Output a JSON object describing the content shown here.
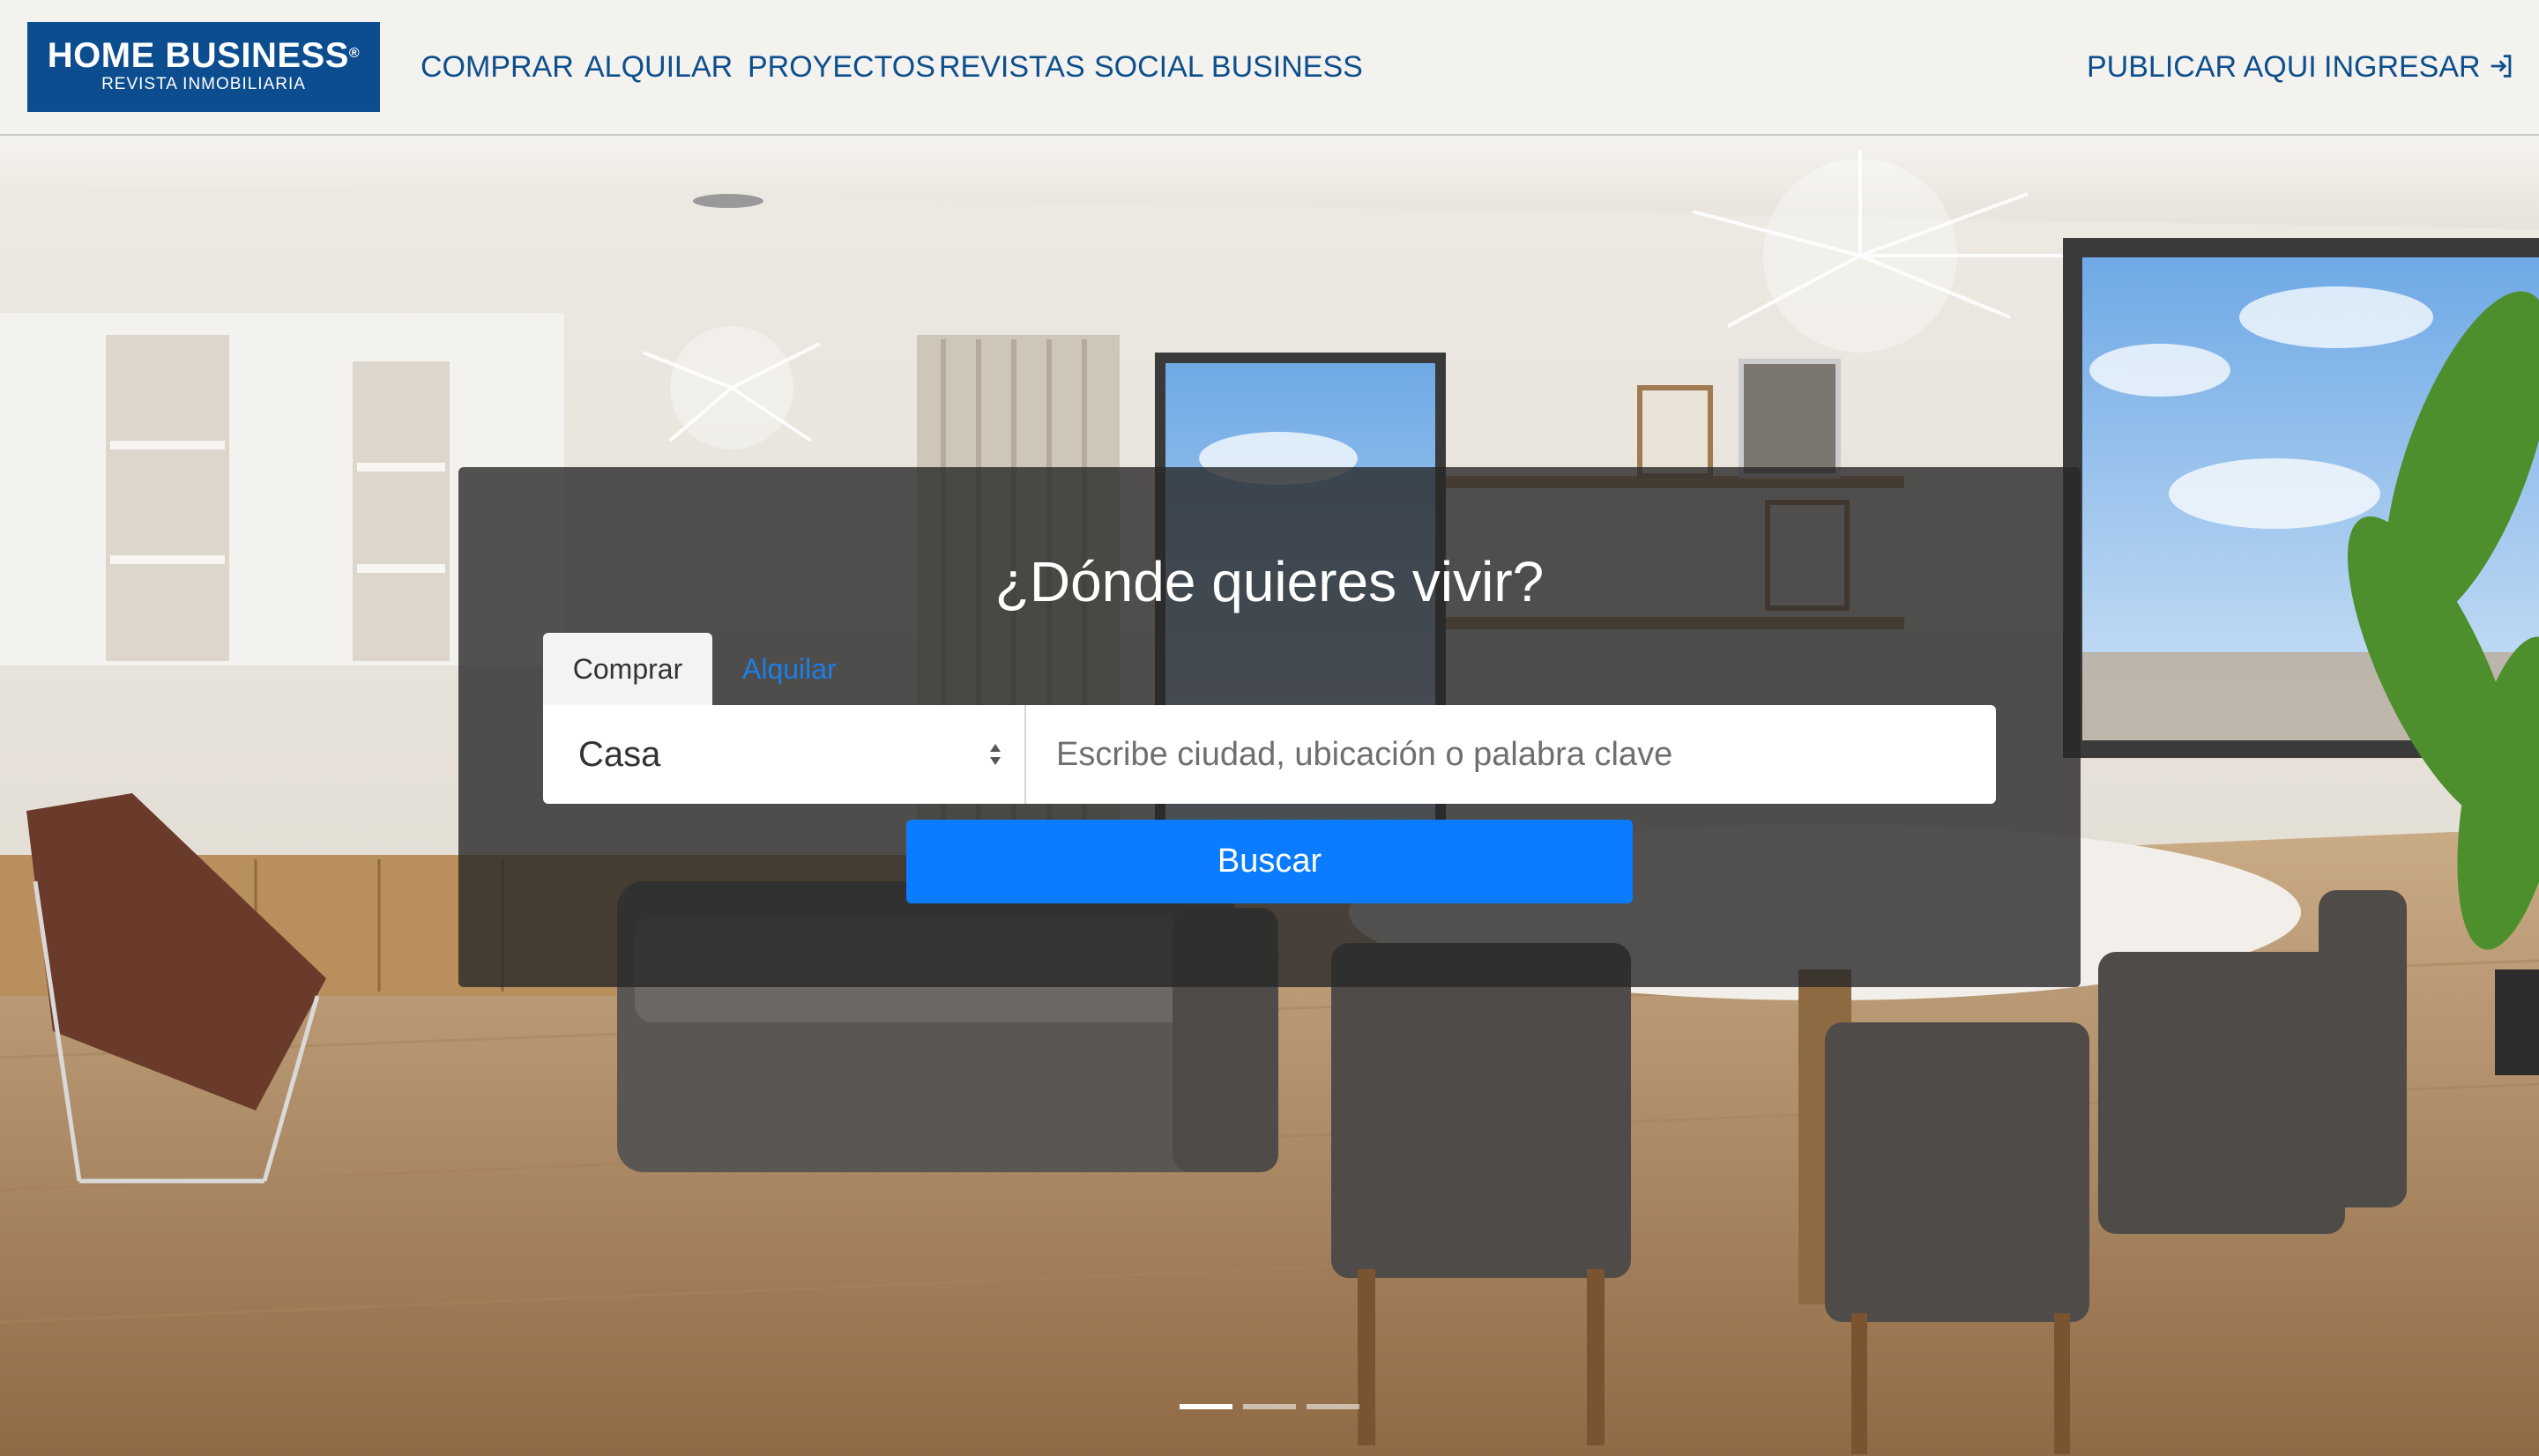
{
  "header": {
    "logo": {
      "brand": "HOME BUSINESS",
      "registered": "®",
      "tagline": "REVISTA INMOBILIARIA"
    },
    "nav": [
      "COMPRAR",
      "ALQUILAR",
      "PROYECTOS",
      "REVISTAS",
      "SOCIAL BUSINESS"
    ],
    "publish_label": "PUBLICAR AQUI",
    "login_label": "INGRESAR",
    "login_icon": "login-arrow-icon"
  },
  "search": {
    "headline": "¿Dónde quieres vivir?",
    "tabs": [
      "Comprar",
      "Alquilar"
    ],
    "active_tab": "Comprar",
    "property_type": "Casa",
    "keyword_placeholder": "Escribe ciudad, ubicación o palabra clave",
    "keyword_value": "",
    "button_label": "Buscar"
  },
  "carousel": {
    "slide_count": 3,
    "active_slide": 1
  },
  "colors": {
    "brand_blue": "#0b4d8f",
    "nav_text": "#0d4f8c",
    "button_blue": "#0b7cff",
    "tab_active_text": "#1a7fe6"
  }
}
